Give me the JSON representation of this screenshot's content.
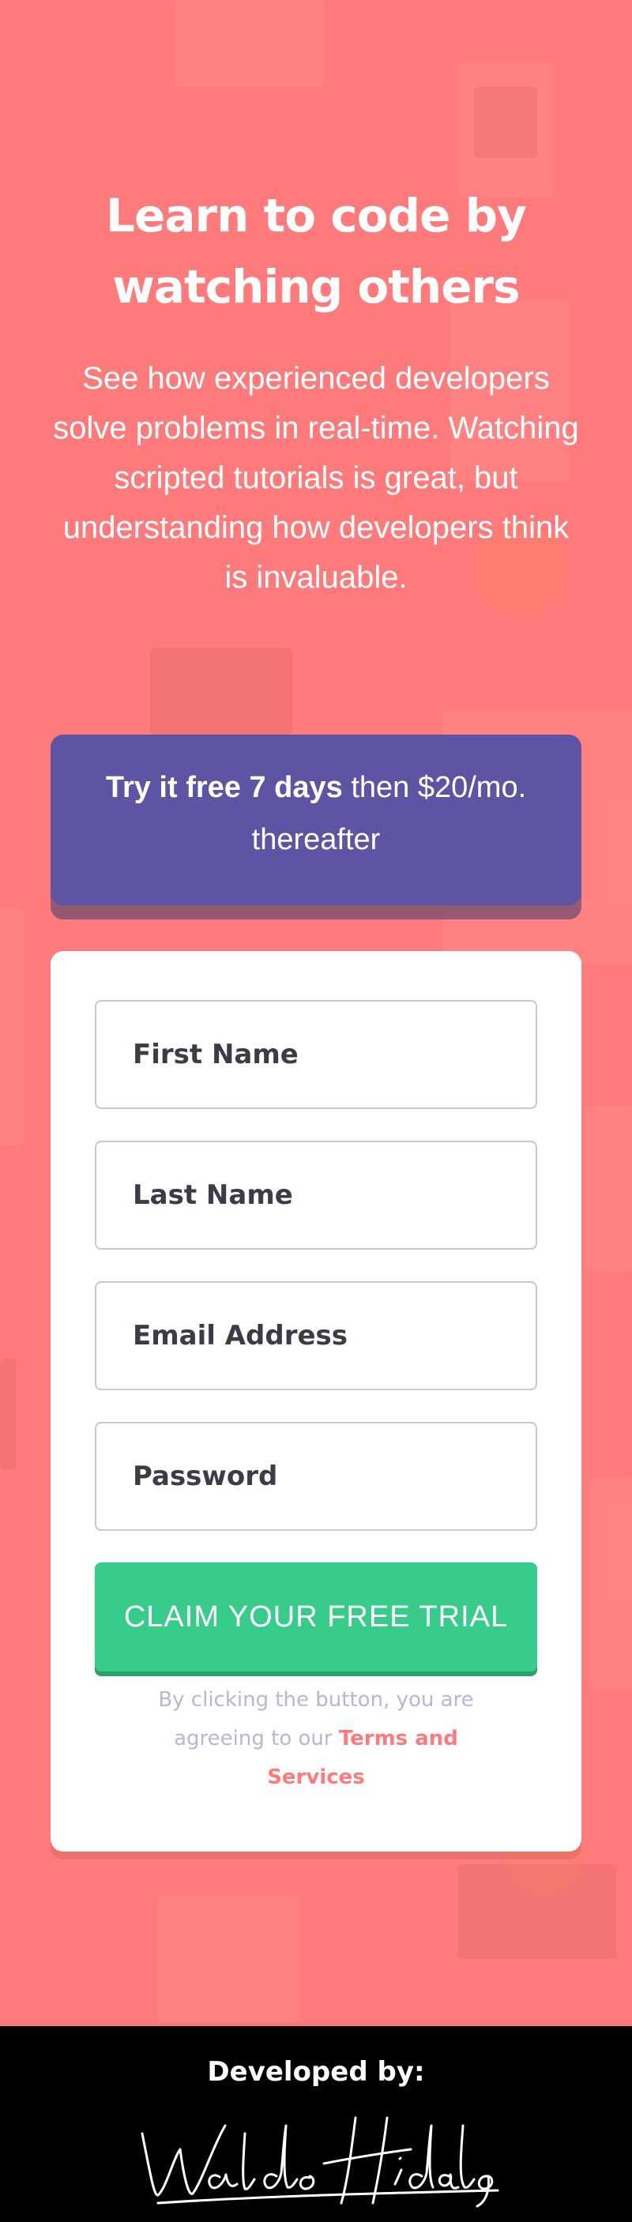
{
  "hero": {
    "title": "Learn to code by watching others",
    "description": "See how experienced developers solve problems in real-time. Watching scripted tutorials is great, but understanding how developers think is invaluable."
  },
  "offer": {
    "bold": "Try it free 7 days",
    "rest": "then $20/mo. thereafter"
  },
  "form": {
    "first_name_placeholder": "First Name",
    "last_name_placeholder": "Last Name",
    "email_placeholder": "Email Address",
    "password_placeholder": "Password",
    "submit_label": "CLAIM YOUR FREE TRIAL",
    "terms_text": "By clicking the button, you are agreeing to our",
    "terms_link": "Terms and Services"
  },
  "footer": {
    "label": "Developed by:",
    "signature": "Waldo Hidalgo"
  },
  "colors": {
    "background": "#ff7a7a",
    "offer": "#5e54a4",
    "cta": "#38cc8b",
    "text_muted": "#b9b6d3"
  }
}
